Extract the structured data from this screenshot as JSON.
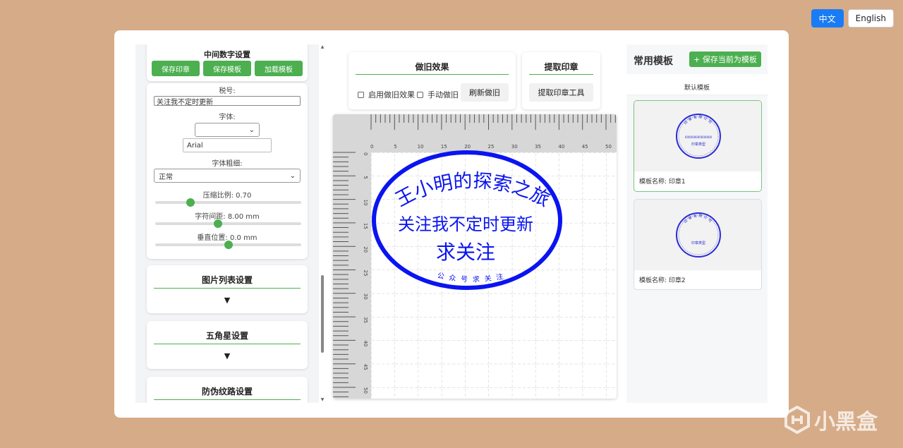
{
  "lang": {
    "zh": "中文",
    "en": "English"
  },
  "left": {
    "middle_text_title": "中间数字设置",
    "buttons": {
      "save_stamp": "保存印章",
      "save_template": "保存模板",
      "load_template": "加载模板"
    },
    "tax_label": "税号:",
    "tax_value": "关注我不定时更新",
    "font_label": "字体:",
    "font_select_value": "",
    "font_input_value": "Arial",
    "weight_label": "字体粗细:",
    "weight_value": "正常",
    "compress_label": "压缩比例:",
    "compress_value": "0.70",
    "compress_fraction": 0.24,
    "spacing_label": "字符间距:",
    "spacing_value": "8.00 mm",
    "spacing_fraction": 0.43,
    "vertical_label": "垂直位置:",
    "vertical_value": "0.0 mm",
    "vertical_fraction": 0.5,
    "image_list_title": "图片列表设置",
    "star_title": "五角星设置",
    "anti_fake_title": "防伪纹路设置",
    "collapse_glyph": "▼"
  },
  "effects": {
    "aging_title": "做旧效果",
    "enable_aging": "启用做旧效果",
    "manual_aging": "手动做旧",
    "refresh_aging": "刷新做旧",
    "extract_title": "提取印章",
    "extract_tool": "提取印章工具"
  },
  "ruler": {
    "top_ticks": [
      "0",
      "5",
      "10",
      "15",
      "20",
      "25",
      "30",
      "35",
      "40",
      "45",
      "50"
    ],
    "left_ticks": [
      "0",
      "5",
      "10",
      "15",
      "20",
      "25",
      "30",
      "35",
      "40",
      "45",
      "50"
    ]
  },
  "stamp": {
    "color": "#0a14f0",
    "company": "王小明的探索之旅",
    "line1": "关注我不定时更新",
    "line2": "求关注",
    "bottom": "公众号求关注"
  },
  "templates": {
    "title": "常用模板",
    "save_current": "+ 保存当前为模板",
    "default_label": "默认模板",
    "items": [
      {
        "name": "模板名称: 印章1",
        "ring_text": "印章有限公司",
        "middle": "000000000000000",
        "type": "印章类型"
      },
      {
        "name": "模板名称: 印章2",
        "ring_text": "印章有限公司",
        "middle": "",
        "type": "印章类型"
      }
    ]
  },
  "watermark": "小黑盒"
}
